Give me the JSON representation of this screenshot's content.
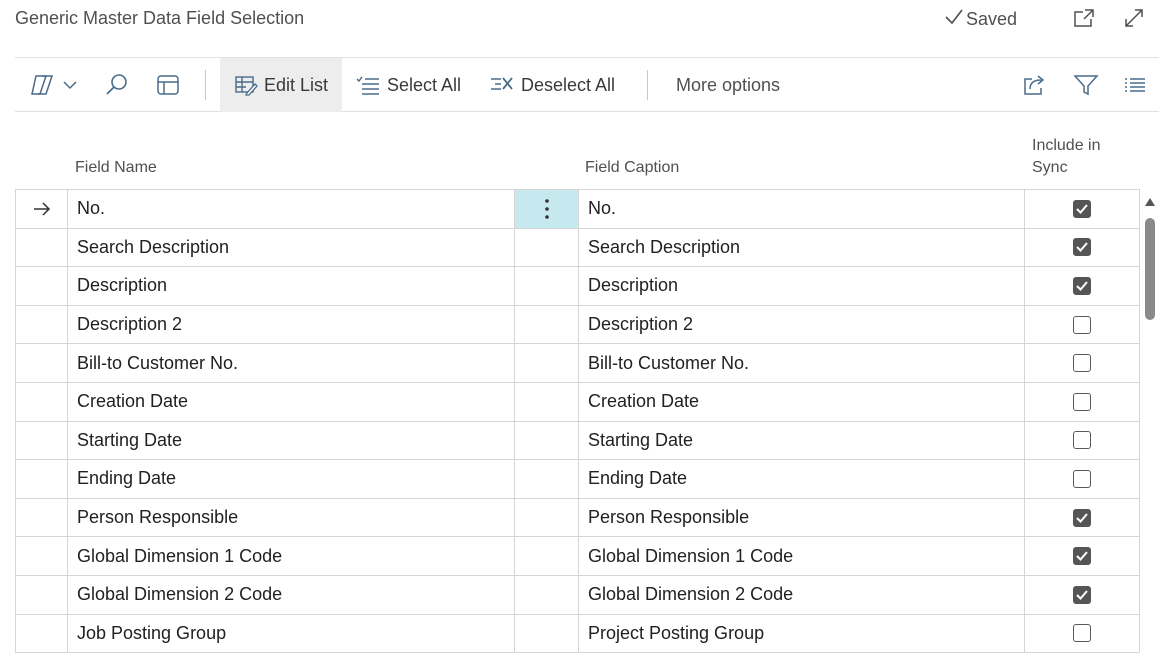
{
  "header": {
    "title": "Generic Master Data Field Selection",
    "saved_label": "Saved"
  },
  "toolbar": {
    "edit_list": "Edit List",
    "select_all": "Select All",
    "deselect_all": "Deselect All",
    "more_options": "More options"
  },
  "columns": {
    "field_name": "Field Name",
    "field_caption": "Field Caption",
    "include_line1": "Include in",
    "include_line2": "Sync"
  },
  "rows": [
    {
      "field_name": "No.",
      "field_caption": "No.",
      "include": true
    },
    {
      "field_name": "Search Description",
      "field_caption": "Search Description",
      "include": true
    },
    {
      "field_name": "Description",
      "field_caption": "Description",
      "include": true
    },
    {
      "field_name": "Description 2",
      "field_caption": "Description 2",
      "include": false
    },
    {
      "field_name": "Bill-to Customer No.",
      "field_caption": "Bill-to Customer No.",
      "include": false
    },
    {
      "field_name": "Creation Date",
      "field_caption": "Creation Date",
      "include": false
    },
    {
      "field_name": "Starting Date",
      "field_caption": "Starting Date",
      "include": false
    },
    {
      "field_name": "Ending Date",
      "field_caption": "Ending Date",
      "include": false
    },
    {
      "field_name": "Person Responsible",
      "field_caption": "Person Responsible",
      "include": true
    },
    {
      "field_name": "Global Dimension 1 Code",
      "field_caption": "Global Dimension 1 Code",
      "include": true
    },
    {
      "field_name": "Global Dimension 2 Code",
      "field_caption": "Global Dimension 2 Code",
      "include": true
    },
    {
      "field_name": "Job Posting Group",
      "field_caption": "Project Posting Group",
      "include": false
    }
  ],
  "colors": {
    "selected_menu_cell": "#c5e9ee",
    "icon": "#4a6b8a"
  }
}
